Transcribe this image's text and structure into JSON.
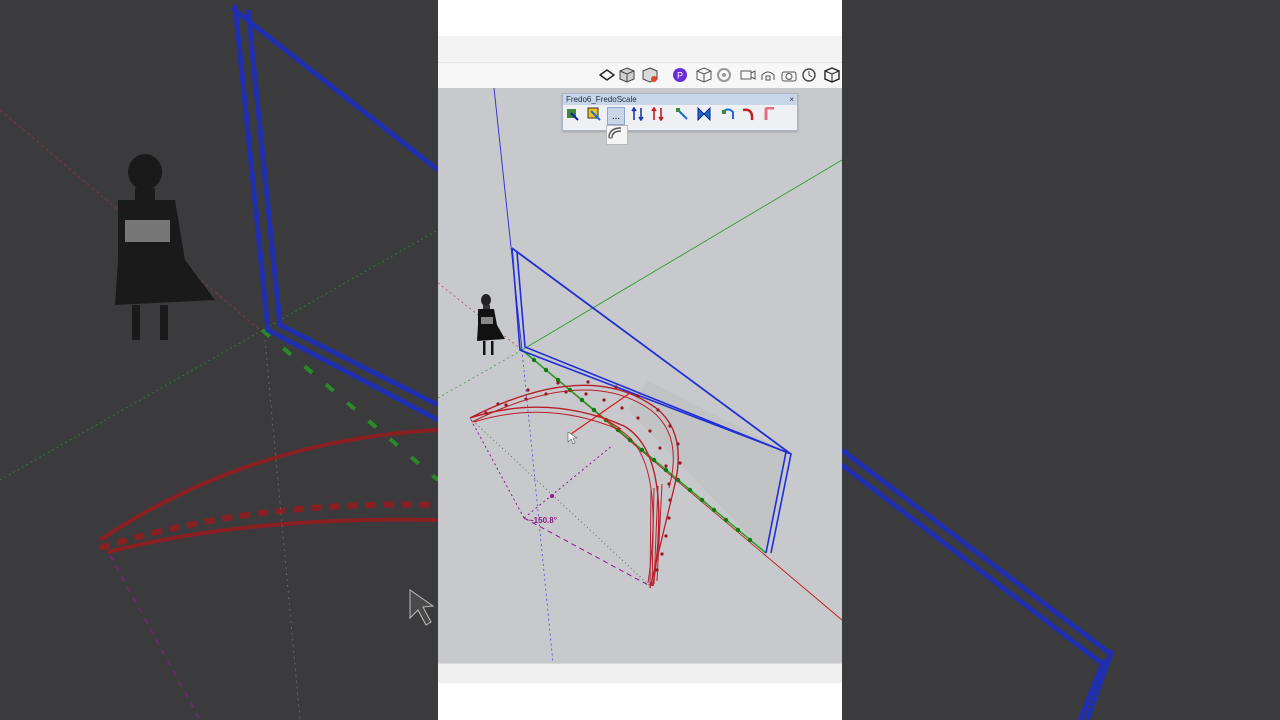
{
  "panel": {
    "title": "Fredo6_FredoScale",
    "close": "×",
    "more": "..."
  },
  "viewport": {
    "angle_label": "~150.8°"
  },
  "icons": {
    "main_toolbar": [
      "section-plane-icon",
      "iso-view-icon",
      "component-icon",
      "profile-icon",
      "shaded-icon",
      "xray-icon",
      "camera-icon",
      "walk-icon",
      "position-camera-icon",
      "look-around-icon",
      "zoom-extents-icon",
      "box-icon"
    ],
    "fredoscale": [
      "scale-icon",
      "box-stretch-icon",
      "more-icon",
      "tapering-icon",
      "twisting-icon",
      "shear-icon",
      "plane-shear-icon",
      "rotate-icon",
      "bend-icon",
      "radial-bend-icon",
      "stretch-icon"
    ],
    "flyout": "radial-bend-icon"
  },
  "colors": {
    "blue_edges": "#1f2fd8",
    "red_selection": "#c81e2a",
    "green_axis": "#2ea02e",
    "protractor": "#8a1a8a"
  }
}
